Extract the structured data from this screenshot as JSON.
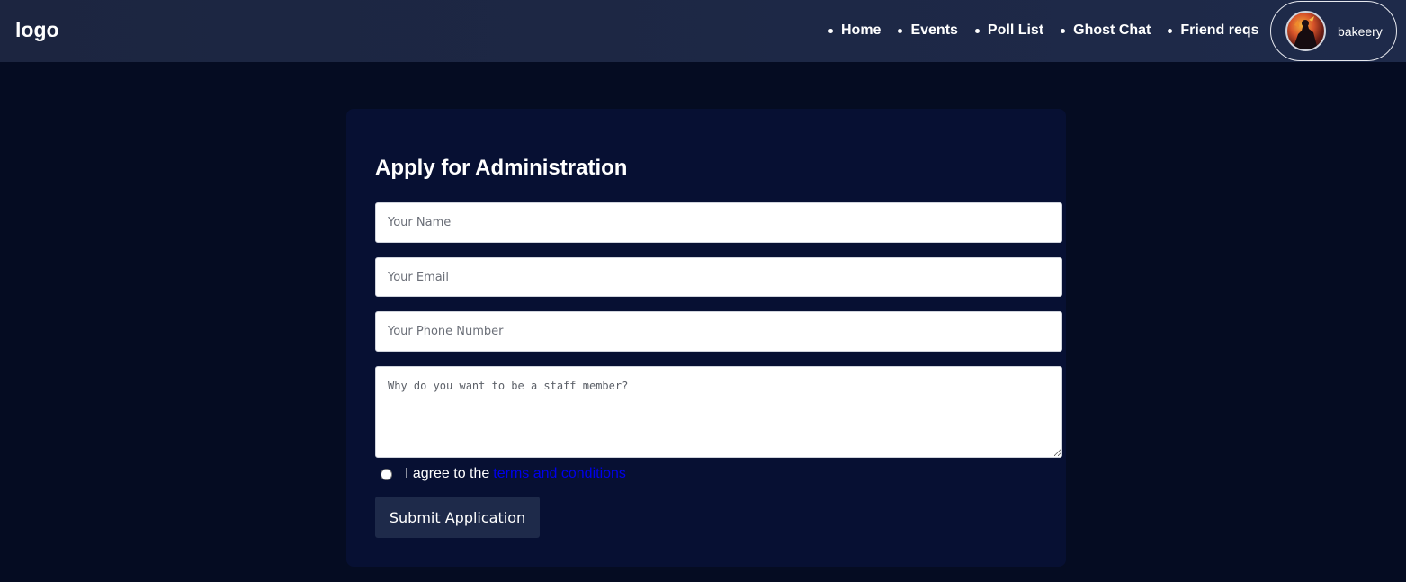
{
  "header": {
    "logo_text": "logo",
    "nav": [
      {
        "label": "Home"
      },
      {
        "label": "Events"
      },
      {
        "label": "Poll List"
      },
      {
        "label": "Ghost Chat"
      },
      {
        "label": "Friend reqs"
      }
    ],
    "profile": {
      "username": "bakeery",
      "avatar_icon": "user-avatar-image"
    }
  },
  "form": {
    "title": "Apply for Administration",
    "name_placeholder": "Your Name",
    "email_placeholder": "Your Email",
    "phone_placeholder": "Your Phone Number",
    "reason_placeholder": "Why do you want to be a staff member?",
    "agree_text": "I agree to the",
    "agree_link": "terms and conditions",
    "agree_checked": false,
    "submit_label": "Submit Application"
  },
  "colors": {
    "page_bg": "#050c22",
    "header_bg": "#1e2a4a",
    "card_bg": "#071033",
    "button_bg": "#1e2a4a",
    "link": "#0000ee"
  }
}
